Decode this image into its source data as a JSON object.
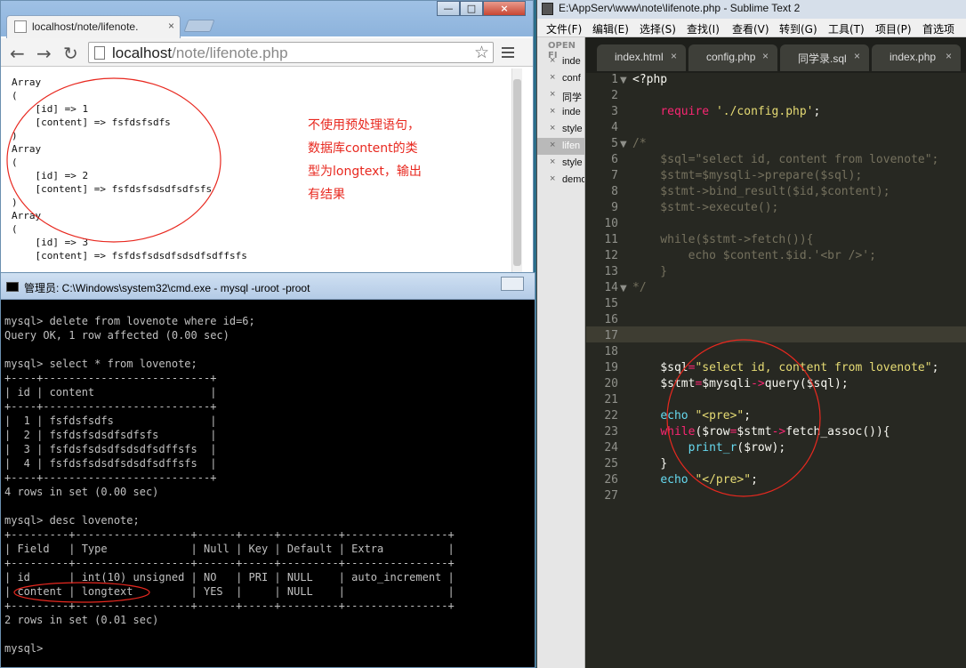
{
  "browser": {
    "tab_title": "localhost/note/lifenote.",
    "tab_close": "×",
    "url_host": "localhost",
    "url_path": "/note/lifenote.php",
    "back": "←",
    "forward": "→",
    "reload": "↻",
    "star": "☆",
    "window_min": "—",
    "window_max": "□",
    "window_close": "×",
    "page_output": "Array\n(\n    [id] => 1\n    [content] => fsfdsfsdfs\n)\nArray\n(\n    [id] => 2\n    [content] => fsfdsfsdsdfsdfsfs\n)\nArray\n(\n    [id] => 3\n    [content] => fsfdsfsdsdfsdsdfsdffsfs",
    "note_lines": [
      "不使用预处理语句，",
      "数据库content的类",
      "型为longtext，输出",
      "有结果"
    ]
  },
  "cmd": {
    "title": "管理员: C:\\Windows\\system32\\cmd.exe - mysql  -uroot -proot",
    "output": "mysql> delete from lovenote where id=6;\nQuery OK, 1 row affected (0.00 sec)\n\nmysql> select * from lovenote;\n+----+--------------------------+\n| id | content                  |\n+----+--------------------------+\n|  1 | fsfdsfsdfs               |\n|  2 | fsfdsfsdsdfsdfsfs        |\n|  3 | fsfdsfsdsdfsdsdfsdffsfs  |\n|  4 | fsfdsfsdsdfsdsdfsdffsfs  |\n+----+--------------------------+\n4 rows in set (0.00 sec)\n\nmysql> desc lovenote;\n+---------+------------------+------+-----+---------+----------------+\n| Field   | Type             | Null | Key | Default | Extra          |\n+---------+------------------+------+-----+---------+----------------+\n| id      | int(10) unsigned | NO   | PRI | NULL    | auto_increment |\n| content | longtext         | YES  |     | NULL    |                |\n+---------+------------------+------+-----+---------+----------------+\n2 rows in set (0.01 sec)\n\nmysql>"
  },
  "sublime": {
    "title": "E:\\AppServ\\www\\note\\lifenote.php - Sublime Text 2",
    "menu": [
      "文件(F)",
      "编辑(E)",
      "选择(S)",
      "查找(I)",
      "查看(V)",
      "转到(G)",
      "工具(T)",
      "项目(P)",
      "首选项"
    ],
    "sidebar_header": "OPEN FI",
    "sidebar_close": "×",
    "sidebar_files": [
      "inde",
      "conf",
      "同学",
      "inde",
      "style",
      "lifen",
      "style",
      "demo"
    ],
    "tabs": [
      "index.html",
      "config.php",
      "同学录.sql",
      "index.php"
    ],
    "tab_close": "×",
    "fold_open": "▼",
    "line_numbers": [
      "1",
      "2",
      "3",
      "4",
      "5",
      "6",
      "7",
      "8",
      "9",
      "10",
      "11",
      "12",
      "13",
      "14",
      "15",
      "16",
      "17",
      "18",
      "19",
      "20",
      "21",
      "22",
      "23",
      "24",
      "25",
      "26",
      "27"
    ],
    "code": {
      "l1": "<?php",
      "l3_kw": "require",
      "l3_str": "'./config.php'",
      "l3_end": ";",
      "l5": "/*",
      "l6": "    $sql=\"select id, content from lovenote\";",
      "l7": "    $stmt=$mysqli->prepare($sql);",
      "l8": "    $stmt->bind_result($id,$content);",
      "l9": "    $stmt->execute();",
      "l11": "    while($stmt->fetch()){",
      "l12": "        echo $content.$id.'<br />';",
      "l13": "    }",
      "l14": "*/",
      "l19_var": "$sql",
      "l19_op": "=",
      "l19_str": "\"select id, content from lovenote\"",
      "l19_end": ";",
      "l20_var": "$stmt",
      "l20_op": "=",
      "l20_var2": "$mysqli",
      "l20_arrow": "->",
      "l20_fn": "query",
      "l20_rest": "($sql);",
      "l22_kw": "echo",
      "l22_str": "\"<pre>\"",
      "l22_end": ";",
      "l23_kw": "while",
      "l23_a": "($row",
      "l23_op": "=",
      "l23_b": "$stmt",
      "l23_arrow": "->",
      "l23_fn": "fetch_assoc",
      "l23_end": "()){",
      "l24_fn": "print_r",
      "l24_rest": "($row);",
      "l25": "}",
      "l26_kw": "echo",
      "l26_str": "\"</pre>\"",
      "l26_end": ";"
    }
  },
  "colors": {
    "annotation": "#e8281f",
    "monokai_bg": "#272822",
    "keyword": "#66d9ef",
    "string": "#e6db74",
    "comment": "#75715e",
    "operator": "#f92672"
  }
}
